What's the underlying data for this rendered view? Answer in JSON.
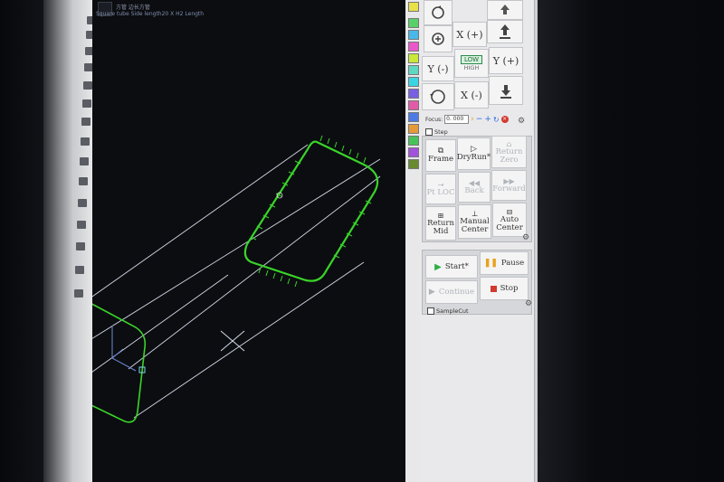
{
  "canvas": {
    "header_label": "方管 边长方管",
    "title": "Square tube Side length20 X H2 Length",
    "center_mark": "x"
  },
  "jog": {
    "x_plus": "X (+)",
    "x_minus": "X (-)",
    "y_plus": "Y (+)",
    "y_minus": "Y (-)",
    "low": "LOW",
    "high": "HIGH"
  },
  "focus": {
    "label": "Focus:",
    "value": "0. 000"
  },
  "step": {
    "label": "Step"
  },
  "motion": {
    "frame": "Frame",
    "dryrun": "DryRun*",
    "return_zero": "Return Zero",
    "pt_loc": "Pt LOC",
    "back": "Back",
    "forward": "Forward",
    "return_mid": "Return Mid",
    "manual_center": "Manual Center",
    "auto_center": "Auto Center"
  },
  "run": {
    "start": "Start*",
    "pause": "Pause",
    "continue": "Continue",
    "stop": "Stop"
  },
  "sample_cut": {
    "label": "SampleCut"
  },
  "colors": {
    "green_part": "#39d42a",
    "accent_red": "#d23a2f",
    "start_green": "#2eae43",
    "pause_orange": "#e8a21a",
    "canvas_bg": "#0c0d10"
  },
  "swatches": [
    "#e9e14a",
    "#5ad06a",
    "#49b7e8",
    "#e957c8",
    "#c9e83a",
    "#5fd8c2",
    "#3bd4e3",
    "#7a5fe0",
    "#e25ba8",
    "#4c7be6",
    "#e59a3a",
    "#48c25b",
    "#a352db",
    "#e65e6a",
    "#5aa9e2",
    "#b4d23c",
    "#8d48d8",
    "#6a8a30"
  ],
  "icons": {
    "rotate": "rotate-icon",
    "gear": "gear-icon"
  }
}
